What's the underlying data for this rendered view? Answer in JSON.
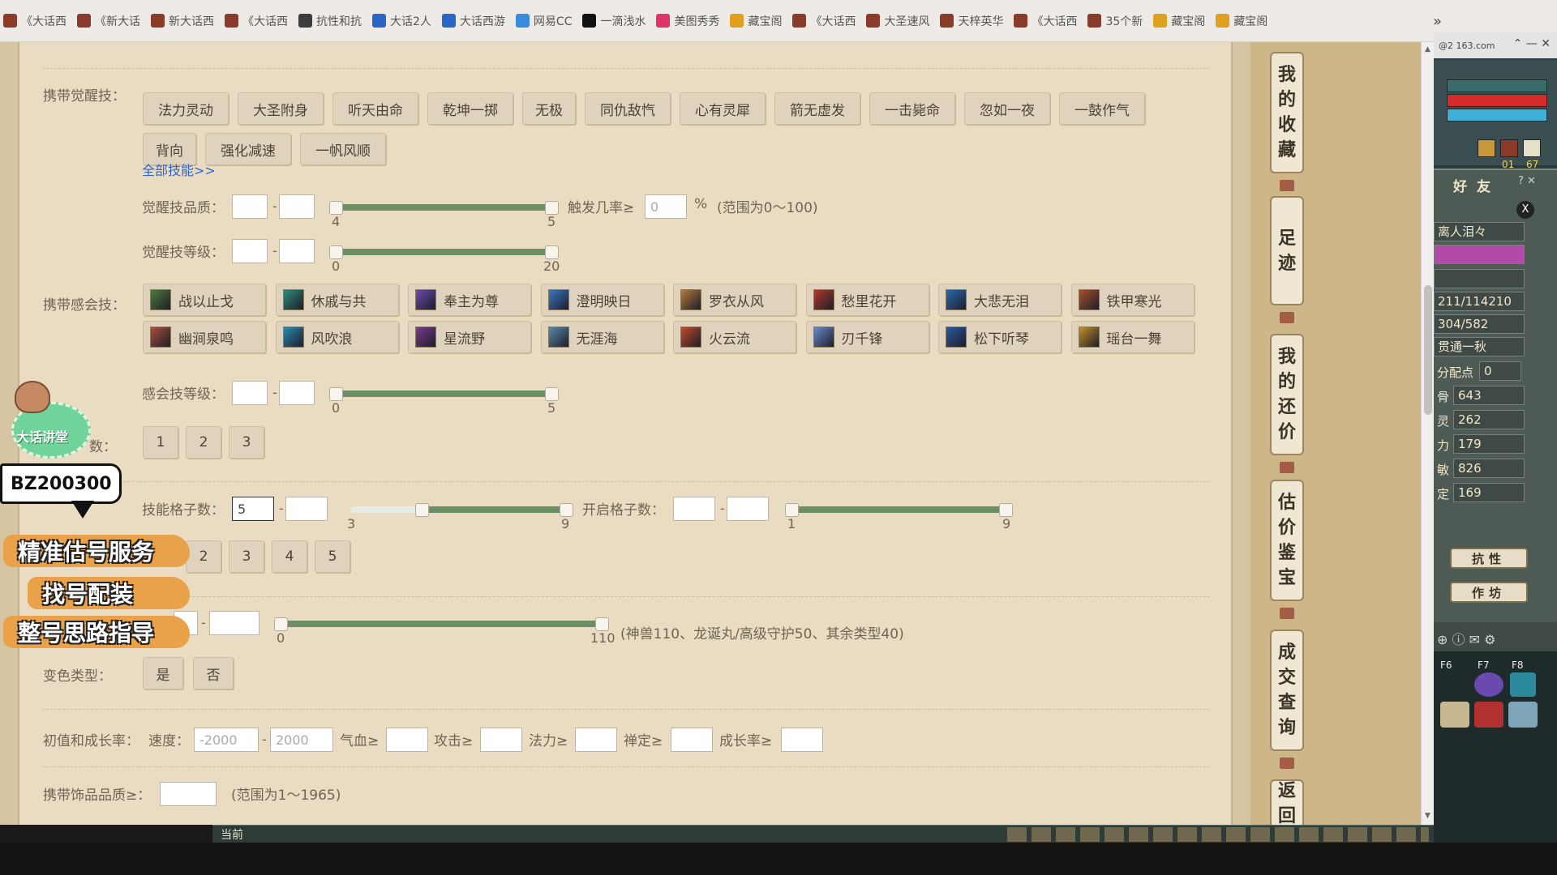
{
  "bookmarks": {
    "items": [
      {
        "label": "《大话西",
        "color": "#8a3b2a"
      },
      {
        "label": "《新大话",
        "color": "#8a3b2a"
      },
      {
        "label": "新大话西",
        "color": "#8a3b2a"
      },
      {
        "label": "《大话西",
        "color": "#8a3b2a"
      },
      {
        "label": "抗性和抗",
        "color": "#3d3d3d"
      },
      {
        "label": "大话2人",
        "color": "#2a66c7"
      },
      {
        "label": "大话西游",
        "color": "#2a66c7"
      },
      {
        "label": "网易CC",
        "color": "#3a8ae0"
      },
      {
        "label": "一滴浅水",
        "color": "#111111"
      },
      {
        "label": "美图秀秀",
        "color": "#e0336b"
      },
      {
        "label": "藏宝阁",
        "color": "#e0a020"
      },
      {
        "label": "《大话西",
        "color": "#8a3b2a"
      },
      {
        "label": "大圣速风",
        "color": "#8a3b2a"
      },
      {
        "label": "天梓英华",
        "color": "#8a3b2a"
      },
      {
        "label": "《大话西",
        "color": "#8a3b2a"
      },
      {
        "label": "35个新",
        "color": "#8a3b2a"
      },
      {
        "label": "藏宝阁",
        "color": "#e0a020"
      },
      {
        "label": "藏宝阁",
        "color": "#e0a020"
      }
    ],
    "more": "»"
  },
  "filters": {
    "awaken_label": "携带觉醒技：",
    "awaken_skills": [
      "法力灵动",
      "大圣附身",
      "听天由命",
      "乾坤一掷",
      "无极",
      "同仇敌忾",
      "心有灵犀",
      "箭无虚发",
      "一击毙命",
      "忽如一夜",
      "一鼓作气",
      "背向",
      "强化减速",
      "一帆风顺"
    ],
    "all_skills_link": "全部技能>>",
    "awaken_quality_label": "觉醒技品质：",
    "awaken_quality_min": 4,
    "awaken_quality_max": 5,
    "trigger_label": "触发几率≥",
    "trigger_value": "0",
    "trigger_unit": "%",
    "trigger_range": "(范围为0～100)",
    "awaken_level_label": "觉醒技等级：",
    "awaken_level_min": 0,
    "awaken_level_max": 20,
    "sense_label": "携带感会技：",
    "sense_skills": [
      {
        "name": "战以止戈",
        "color": "#4f7a3a"
      },
      {
        "name": "休戚与共",
        "color": "#2f8a7a"
      },
      {
        "name": "奉主为尊",
        "color": "#6a4aa8"
      },
      {
        "name": "澄明映日",
        "color": "#3a78c0"
      },
      {
        "name": "罗衣从风",
        "color": "#b27a3a"
      },
      {
        "name": "愁里花开",
        "color": "#b03a2a"
      },
      {
        "name": "大悲无泪",
        "color": "#2a6ab0"
      },
      {
        "name": "铁甲寒光",
        "color": "#a8502a"
      },
      {
        "name": "幽涧泉鸣",
        "color": "#a8503a"
      },
      {
        "name": "风吹浪",
        "color": "#2a8ab0"
      },
      {
        "name": "星流野",
        "color": "#7a3a8a"
      },
      {
        "name": "无涯海",
        "color": "#5a8aa8"
      },
      {
        "name": "火云流",
        "color": "#c04a2a"
      },
      {
        "name": "刃千锋",
        "color": "#6a8ac8"
      },
      {
        "name": "松下听琴",
        "color": "#2a5aa0"
      },
      {
        "name": "瑶台一舞",
        "color": "#c0902a"
      }
    ],
    "sense_level_label": "感会技等级：",
    "sense_level_min": 0,
    "sense_level_max": 5,
    "count_label_partial": "数：",
    "count_options": [
      "1",
      "2",
      "3"
    ],
    "slot_label": "技能格子数：",
    "slot_min_value": "5",
    "slot_range_min": 3,
    "slot_range_max": 9,
    "open_slot_label": "开启格子数：",
    "open_slot_min": 1,
    "open_slot_max": 9,
    "num_options": [
      "2",
      "3",
      "4",
      "5"
    ],
    "neidan_min": 0,
    "neidan_max": 110,
    "neidan_note": "(神兽110、龙诞丸/高级守护50、其余类型40)",
    "color_label": "变色类型：",
    "color_yes": "是",
    "color_no": "否",
    "init_label": "初值和成长率：",
    "speed_label": "速度：",
    "speed_min": "-2000",
    "speed_max": "2000",
    "hp_label": "气血≥",
    "atk_label": "攻击≥",
    "mp_label": "法力≥",
    "zen_label": "禅定≥",
    "growth_label": "成长率≥",
    "accessory_label": "携带饰品品质≥：",
    "accessory_range": "(范围为1～1965)"
  },
  "side_nav": {
    "items": [
      "我的收藏",
      "足迹",
      "我的还价",
      "估价鉴宝",
      "成交查询",
      "返回"
    ]
  },
  "game": {
    "top_text": "@2 163.com",
    "friends_title": "好友",
    "friend_name": "离人泪々",
    "hp_text": "211/114210",
    "mp_text": "304/582",
    "title_text": "贯通一秋",
    "point_label": "分配点",
    "point_value": "0",
    "stats": [
      {
        "k": "骨",
        "v": "643"
      },
      {
        "k": "灵",
        "v": "262"
      },
      {
        "k": "力",
        "v": "179"
      },
      {
        "k": "敏",
        "v": "826"
      },
      {
        "k": "定",
        "v": "169"
      }
    ],
    "btn_resist": "抗性",
    "btn_workshop": "作坊",
    "level_a": "01",
    "level_b": "67",
    "f7": "F7",
    "f8": "F8",
    "f6": "F6",
    "bottom_label": "当前"
  },
  "overlay": {
    "mascot_label": "大话讲堂",
    "id": "BZ200300",
    "promo_1": "精准估号服务",
    "promo_2": "找号配装",
    "promo_3": "整号思路指导"
  }
}
